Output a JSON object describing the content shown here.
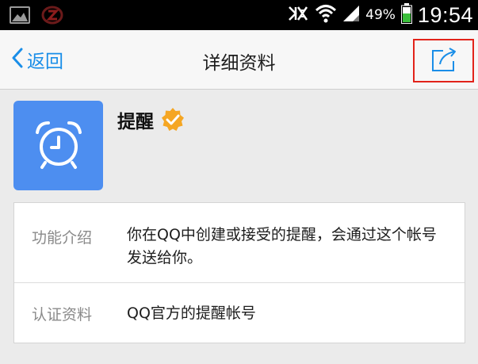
{
  "status_bar": {
    "battery_percent": "49%",
    "time": "19:54",
    "icons": [
      "gallery-icon",
      "notification-icon",
      "mute-icon",
      "wifi-icon",
      "signal-icon",
      "battery-icon"
    ]
  },
  "nav": {
    "back_label": "返回",
    "title": "详细资料",
    "share_icon": "share-icon"
  },
  "profile": {
    "name": "提醒",
    "avatar_icon": "alarm-clock-icon",
    "verified_icon": "verified-badge-icon",
    "colors": {
      "avatar_bg": "#4d8ef0",
      "verified": "#f5a623",
      "accent": "#1a8ee8"
    }
  },
  "info": [
    {
      "label": "功能介绍",
      "value": "你在QQ中创建或接受的提醒，会通过这个帐号发送给你。"
    },
    {
      "label": "认证资料",
      "value": "QQ官方的提醒帐号"
    }
  ]
}
